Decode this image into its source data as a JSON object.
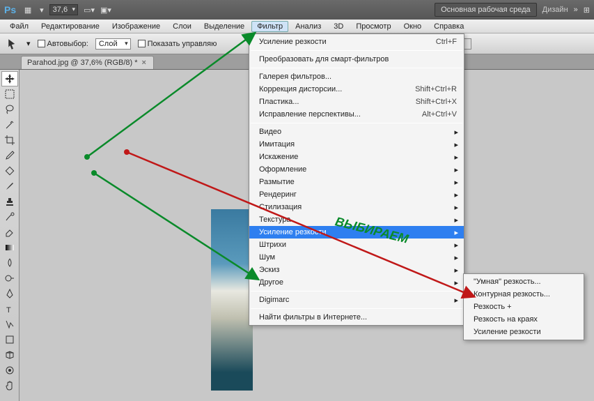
{
  "title": {
    "logo": "Ps",
    "zoom": "37,6",
    "workspace": "Основная рабочая среда",
    "design": "Дизайн"
  },
  "menu": [
    "Файл",
    "Редактирование",
    "Изображение",
    "Слои",
    "Выделение",
    "Фильтр",
    "Анализ",
    "3D",
    "Просмотр",
    "Окно",
    "Справка"
  ],
  "menu_active_index": 5,
  "options": {
    "autoselect": "Автовыбор:",
    "layer": "Слой",
    "show_controls": "Показать управляю"
  },
  "tab": {
    "name": "Parahod.jpg @ 37,6% (RGB/8) *"
  },
  "filter_menu": {
    "sharpen_repeat": {
      "label": "Усиление резкости",
      "shortcut": "Ctrl+F"
    },
    "smart": "Преобразовать для смарт-фильтров",
    "gallery": "Галерея фильтров...",
    "lens": {
      "label": "Коррекция дисторсии...",
      "shortcut": "Shift+Ctrl+R"
    },
    "liquify": {
      "label": "Пластика...",
      "shortcut": "Shift+Ctrl+X"
    },
    "vanish": {
      "label": "Исправление перспективы...",
      "shortcut": "Alt+Ctrl+V"
    },
    "groups": [
      "Видео",
      "Имитация",
      "Искажение",
      "Оформление",
      "Размытие",
      "Рендеринг",
      "Стилизация",
      "Текстура",
      "Усиление резкости",
      "Штрихи",
      "Шум",
      "Эскиз",
      "Другое"
    ],
    "digimarc": "Digimarc",
    "online": "Найти фильтры в Интернете..."
  },
  "submenu": [
    "\"Умная\" резкость...",
    "Контурная резкость...",
    "Резкость +",
    "Резкость на краях",
    "Усиление резкости"
  ],
  "annotation": "ВЫБИРАЕМ"
}
